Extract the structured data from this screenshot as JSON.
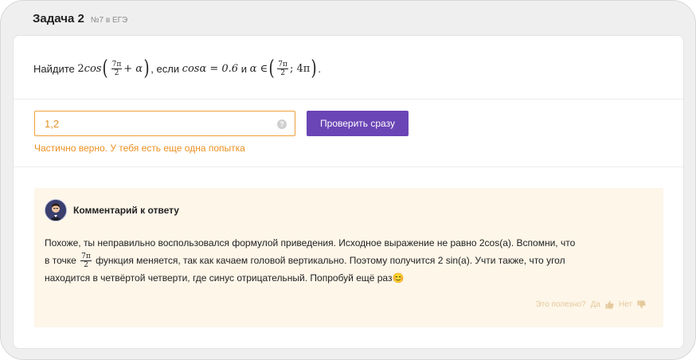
{
  "task": {
    "title": "Задача 2",
    "subtitle": "№7 в ЕГЭ"
  },
  "question": {
    "prefix": "Найдите",
    "expr_coef": "2",
    "expr_func": "cos",
    "frac1_num": "7π",
    "frac1_den": "2",
    "plus_alpha": "+ α",
    "middle": ", если",
    "cond": "cosα = 0.6",
    "and_text": "и",
    "alpha_in": "α ∈",
    "frac2_num": "7π",
    "frac2_den": "2",
    "interval_rest": "; 4π",
    "end": "."
  },
  "answer": {
    "value": "1,2",
    "help_icon": "?"
  },
  "check_button": {
    "label": "Проверить сразу"
  },
  "status": {
    "text": "Частично верно. У тебя есть еще одна попытка",
    "color": "#ec8f1f"
  },
  "comment": {
    "title": "Комментарий к ответу",
    "line1": "Похоже, ты неправильно воспользовался формулой приведения. Исходное выражение не равно 2cos(a). Вспомни, что",
    "line2_start": "в точке",
    "frac_num": "7π",
    "frac_den": "2",
    "line2_end": "функция меняется, так как качаем головой вертикально. Поэтому получится 2 sin(a). Учти также, что угол",
    "line3": "находится в четвёртой четверти, где синус отрицательный. Попробуй ещё раз",
    "emoji": "😊"
  },
  "feedback": {
    "question": "Это полезно?",
    "yes": "Да",
    "no": "Нет"
  },
  "colors": {
    "accent": "#6a45b5",
    "warning": "#ec8f1f",
    "comment_bg": "#fdf6e9"
  }
}
